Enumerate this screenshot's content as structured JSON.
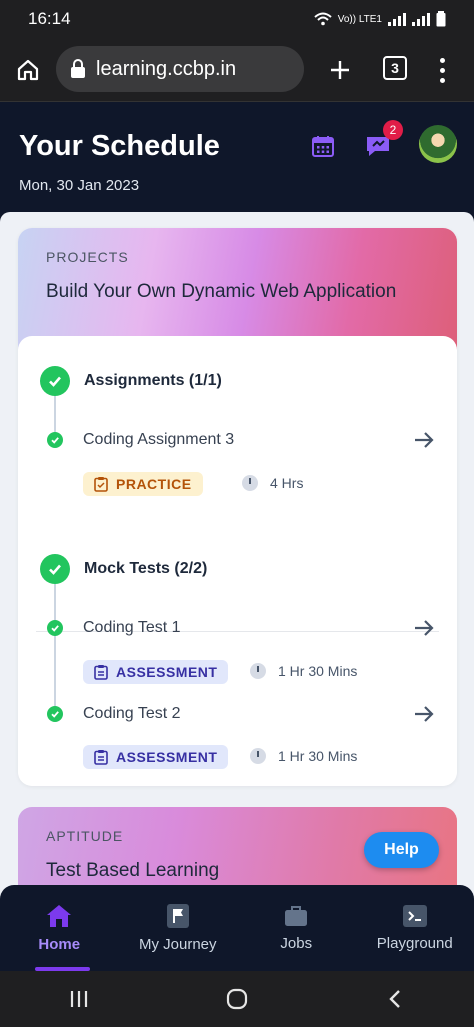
{
  "status": {
    "time": "16:14",
    "network": "Vo)) LTE1"
  },
  "browser": {
    "url": "learning.ccbp.in",
    "tab_count": "3"
  },
  "header": {
    "title": "Your Schedule",
    "date": "Mon, 30 Jan 2023",
    "chat_badge": "2"
  },
  "project_card": {
    "tag": "PROJECTS",
    "title": "Build Your Own Dynamic Web Application",
    "sections": [
      {
        "label": "Assignments (1/1)",
        "items": [
          {
            "title": "Coding Assignment 3",
            "chip": "PRACTICE",
            "duration": "4 Hrs"
          }
        ]
      },
      {
        "label": "Mock Tests (2/2)",
        "items": [
          {
            "title": "Coding Test 1",
            "chip": "ASSESSMENT",
            "duration": "1 Hr 30 Mins"
          },
          {
            "title": "Coding Test 2",
            "chip": "ASSESSMENT",
            "duration": "1 Hr 30 Mins"
          }
        ]
      }
    ]
  },
  "aptitude_card": {
    "tag": "APTITUDE",
    "title": "Test Based Learning"
  },
  "help_button": "Help",
  "bottom_nav": [
    {
      "label": "Home",
      "icon": "home-icon",
      "active": true
    },
    {
      "label": "My Journey",
      "icon": "flag-icon",
      "active": false
    },
    {
      "label": "Jobs",
      "icon": "briefcase-icon",
      "active": false
    },
    {
      "label": "Playground",
      "icon": "terminal-icon",
      "active": false
    }
  ],
  "colors": {
    "accent": "#7c3aed",
    "success": "#22c55e",
    "help": "#1d8cf0",
    "header_bg": "#0f172a"
  }
}
